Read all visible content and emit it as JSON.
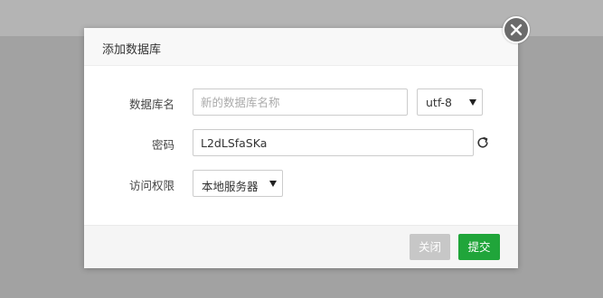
{
  "dialog": {
    "title": "添加数据库",
    "close_icon": "close-icon"
  },
  "form": {
    "db_name": {
      "label": "数据库名",
      "value": "",
      "placeholder": "新的数据库名称"
    },
    "charset": {
      "selected": "utf-8"
    },
    "password": {
      "label": "密码",
      "value": "L2dLSfaSKa",
      "refresh_icon": "refresh-icon"
    },
    "access": {
      "label": "访问权限",
      "selected": "本地服务器"
    }
  },
  "footer": {
    "close_label": "关闭",
    "submit_label": "提交"
  },
  "colors": {
    "accent": "#20a53a",
    "close_button": "#c7c7c7",
    "overlay": "#a6a6a6"
  }
}
